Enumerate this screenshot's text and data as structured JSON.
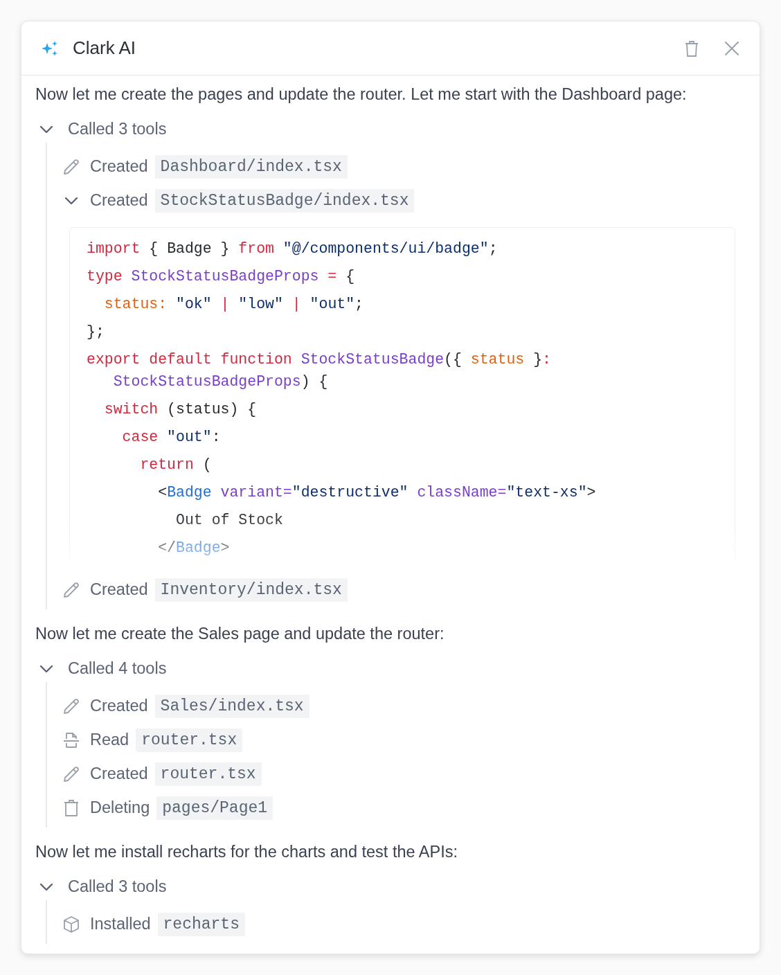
{
  "window": {
    "title": "Clark AI"
  },
  "messages": [
    {
      "kind": "text",
      "text": "Now let me create the pages and update the router. Let me start with the Dashboard page:"
    },
    {
      "kind": "tools",
      "label": "Called 3 tools",
      "expanded": true,
      "items": [
        {
          "kind": "edit",
          "verb": "Created",
          "file": "Dashboard/index.tsx"
        },
        {
          "kind": "code",
          "verb": "Created",
          "file": "StockStatusBadge/index.tsx",
          "expanded": true,
          "code": [
            [
              {
                "kind": "kw",
                "s": "import"
              },
              {
                "kind": "plain",
                "s": " { Badge } "
              },
              {
                "kind": "kw",
                "s": "from"
              },
              {
                "kind": "str",
                "s": " \"@/components/ui/badge\""
              },
              {
                "kind": "plain",
                "s": ";"
              }
            ],
            [
              {
                "kind": "kw",
                "s": "type"
              },
              {
                "kind": "type",
                "s": " StockStatusBadgeProps"
              },
              {
                "kind": "kw",
                "s": " = "
              },
              {
                "kind": "plain",
                "s": "{"
              }
            ],
            [
              {
                "kind": "prop",
                "s": "  status:"
              },
              {
                "kind": "str",
                "s": " \"ok\""
              },
              {
                "kind": "kw",
                "s": " | "
              },
              {
                "kind": "str",
                "s": "\"low\""
              },
              {
                "kind": "kw",
                "s": " | "
              },
              {
                "kind": "str",
                "s": "\"out\""
              },
              {
                "kind": "plain",
                "s": ";"
              }
            ],
            [
              {
                "kind": "plain",
                "s": "};"
              }
            ],
            [
              {
                "kind": "kw",
                "s": "export default function"
              },
              {
                "kind": "type",
                "s": " StockStatusBadge"
              },
              {
                "kind": "plain",
                "s": "({ "
              },
              {
                "kind": "prop",
                "s": "status"
              },
              {
                "kind": "plain",
                "s": " }"
              },
              {
                "kind": "kw",
                "s": ":"
              }
            ],
            [
              {
                "kind": "type",
                "s": "   StockStatusBadgeProps"
              },
              {
                "kind": "plain",
                "s": ") {"
              }
            ],
            [
              {
                "kind": "kw",
                "s": "  switch"
              },
              {
                "kind": "plain",
                "s": " (status) {"
              }
            ],
            [
              {
                "kind": "kw",
                "s": "    case"
              },
              {
                "kind": "str",
                "s": " \"out\""
              },
              {
                "kind": "plain",
                "s": ":"
              }
            ],
            [
              {
                "kind": "kw",
                "s": "      return"
              },
              {
                "kind": "plain",
                "s": " ("
              }
            ],
            [
              {
                "kind": "plain",
                "s": "        <"
              },
              {
                "kind": "tag",
                "s": "Badge"
              },
              {
                "kind": "type",
                "s": " variant="
              },
              {
                "kind": "str",
                "s": "\"destructive\""
              },
              {
                "kind": "type",
                "s": " className="
              },
              {
                "kind": "str",
                "s": "\"text-xs\""
              },
              {
                "kind": "plain",
                "s": ">"
              }
            ],
            [
              {
                "kind": "plain",
                "s": "          Out of Stock"
              }
            ],
            [
              {
                "kind": "plain",
                "s": "        </"
              },
              {
                "kind": "tag",
                "s": "Badge"
              },
              {
                "kind": "plain",
                "s": ">"
              }
            ]
          ]
        },
        {
          "kind": "edit",
          "verb": "Created",
          "file": "Inventory/index.tsx"
        }
      ]
    },
    {
      "kind": "text",
      "text": "Now let me create the Sales page and update the router:"
    },
    {
      "kind": "tools",
      "label": "Called 4 tools",
      "expanded": true,
      "items": [
        {
          "kind": "edit",
          "verb": "Created",
          "file": "Sales/index.tsx"
        },
        {
          "kind": "read",
          "verb": "Read",
          "file": "router.tsx"
        },
        {
          "kind": "edit",
          "verb": "Created",
          "file": "router.tsx"
        },
        {
          "kind": "delete",
          "verb": "Deleting",
          "file": "pages/Page1"
        }
      ]
    },
    {
      "kind": "text",
      "text": "Now let me install recharts for the charts and test the APIs:"
    },
    {
      "kind": "tools",
      "label": "Called 3 tools",
      "expanded": true,
      "items": [
        {
          "kind": "install",
          "verb": "Installed",
          "file": "recharts"
        }
      ]
    }
  ]
}
